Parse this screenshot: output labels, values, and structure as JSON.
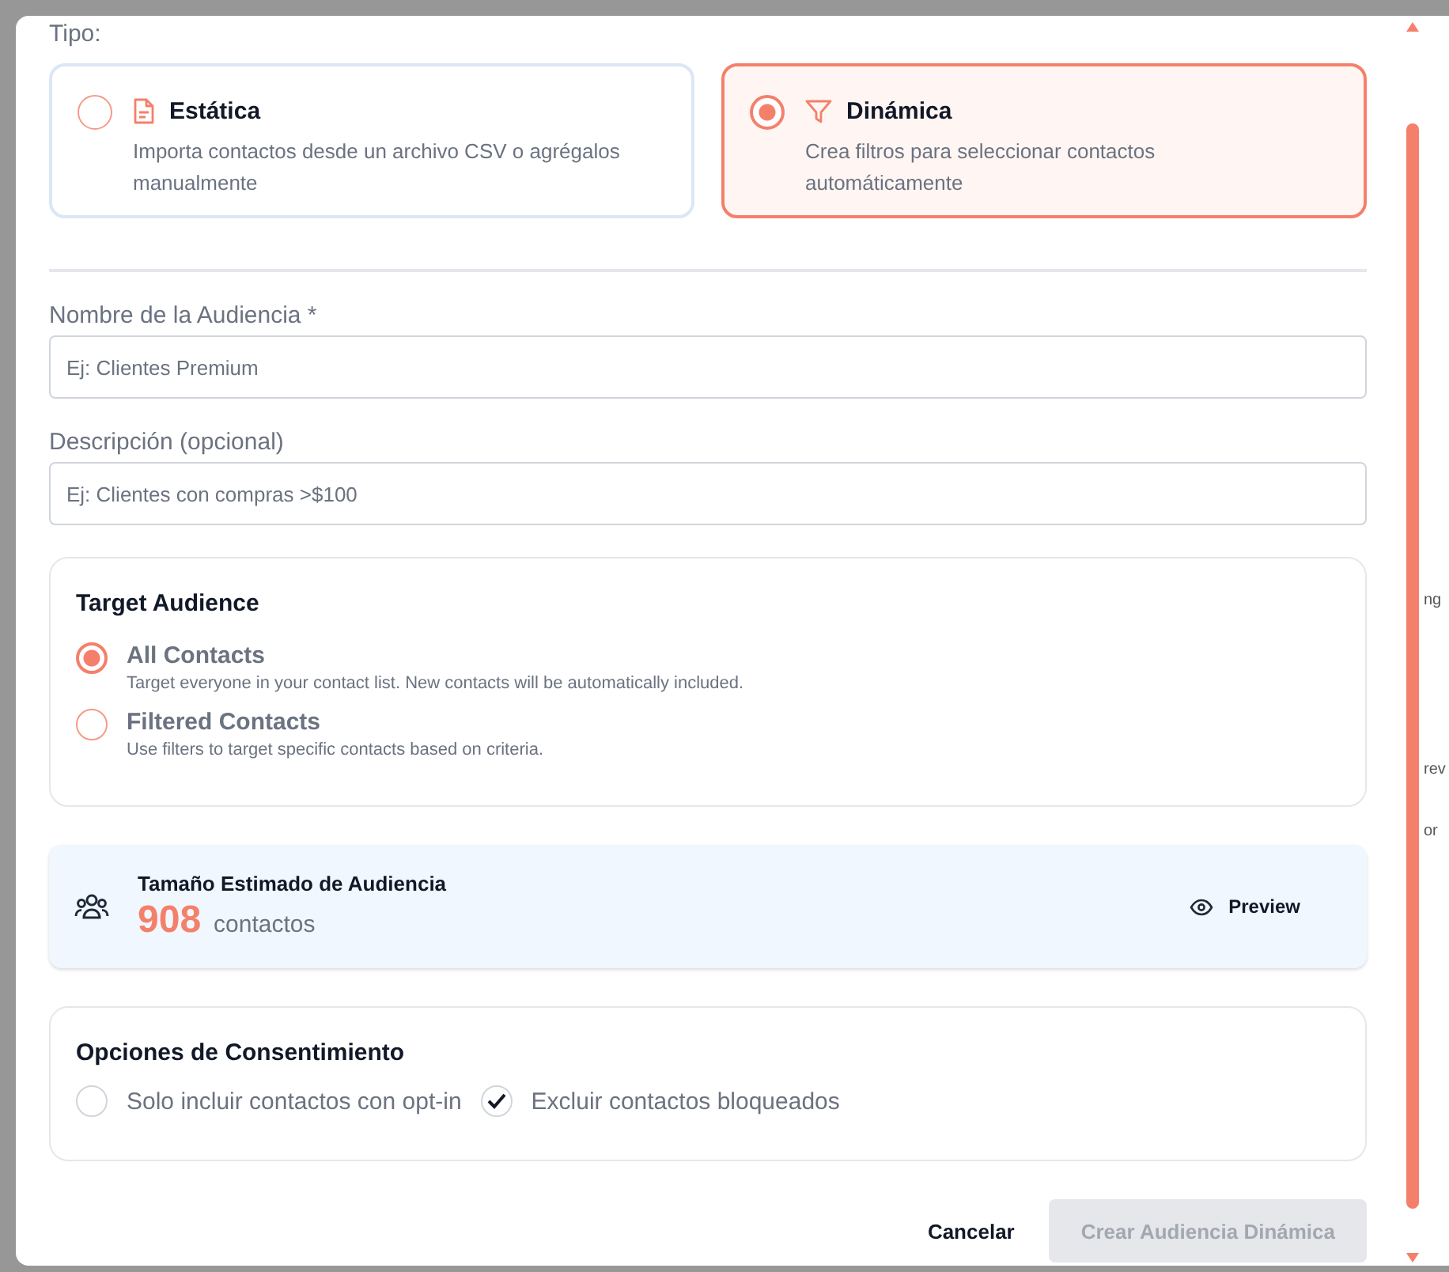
{
  "type_label": "Tipo:",
  "types": [
    {
      "kind": "file",
      "title": "Estática",
      "description": "Importa contactos desde un archivo CSV o agrégalos manualmente",
      "selected": false
    },
    {
      "kind": "filter",
      "title": "Dinámica",
      "description": "Crea filtros para seleccionar contactos automáticamente",
      "selected": true
    }
  ],
  "fields": [
    {
      "label": "Nombre de la Audiencia *",
      "placeholder": "Ej: Clientes Premium"
    },
    {
      "label": "Descripción (opcional)",
      "placeholder": "Ej: Clientes con compras >$100"
    }
  ],
  "target_audience": {
    "title": "Target Audience",
    "options": [
      {
        "label": "All Contacts",
        "description": "Target everyone in your contact list. New contacts will be automatically included.",
        "selected": true
      },
      {
        "label": "Filtered Contacts",
        "description": "Use filters to target specific contacts based on criteria.",
        "selected": false
      }
    ]
  },
  "estimate": {
    "title": "Tamaño Estimado de Audiencia",
    "count": "908",
    "unit": "contactos",
    "preview_button": "Preview"
  },
  "consent": {
    "title": "Opciones de Consentimiento",
    "options": [
      {
        "label": "Solo incluir contactos con opt-in",
        "checked": false
      },
      {
        "label": "Excluir contactos bloqueados",
        "checked": true
      }
    ]
  },
  "footer": {
    "cancel": "Cancelar",
    "submit": {
      "label": "Crear Audiencia Dinámica",
      "disabled": true
    }
  },
  "background_fragments": [
    "ng",
    "rev",
    "or"
  ]
}
